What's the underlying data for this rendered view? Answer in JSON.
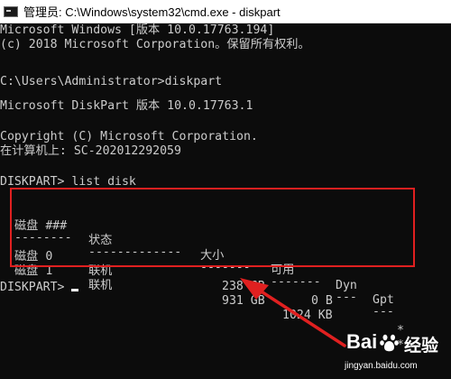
{
  "window": {
    "title": "管理员: C:\\Windows\\system32\\cmd.exe - diskpart"
  },
  "console": {
    "line_version": "Microsoft Windows [版本 10.0.17763.194]",
    "line_copyright": "(c) 2018 Microsoft Corporation。保留所有权利。",
    "line_prompt_cmd": "C:\\Users\\Administrator>diskpart",
    "line_diskpart_version": "Microsoft DiskPart 版本 10.0.17763.1",
    "line_diskpart_copyright": "Copyright (C) Microsoft Corporation.",
    "line_computer": "在计算机上: SC-202012292059",
    "line_list_disk": "DISKPART> list disk",
    "final_prompt": "DISKPART> "
  },
  "disk_table": {
    "headers": [
      "磁盘 ###",
      "状态",
      "大小",
      "可用",
      "Dyn",
      "Gpt"
    ],
    "underlines": [
      "--------",
      "-------------",
      "-------",
      "-------",
      "---",
      "---"
    ],
    "rows": [
      [
        "磁盘 0",
        "联机",
        "238 GB",
        "0 B",
        "",
        "*"
      ],
      [
        "磁盘 1",
        "联机",
        "931 GB",
        "1024 KB",
        "",
        "*"
      ]
    ]
  },
  "annotation": {
    "box_color": "#e02020",
    "arrow_color": "#e02020"
  },
  "watermark": {
    "logo": "Bai",
    "paw_icon": "baidu-paw-icon",
    "cn": "经验",
    "url": "jingyan.baidu.com"
  },
  "colors": {
    "console_bg": "#0c0c0c",
    "console_fg": "#cccccc",
    "titlebar_bg": "#ffffff"
  }
}
